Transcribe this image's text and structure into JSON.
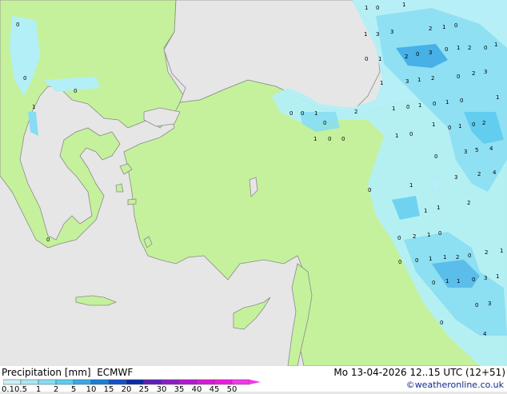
{
  "header": {
    "product": "Precipitation [mm]",
    "model": "ECMWF",
    "valid_time": "Mo 13-04-2026 12..15 UTC (12+51)",
    "credit": "©weatheronline.co.uk"
  },
  "legend": {
    "ticks": [
      "0.1",
      "0.5",
      "1",
      "2",
      "5",
      "10",
      "15",
      "20",
      "25",
      "30",
      "35",
      "40",
      "45",
      "50"
    ],
    "colors": [
      "#c8f0f8",
      "#a8e6f5",
      "#86dcf2",
      "#5ecbef",
      "#3aa7e4",
      "#1a7fd6",
      "#1550c8",
      "#0c2aa6",
      "#5a1fb8",
      "#8b1cc9",
      "#b418d2",
      "#d818d8",
      "#f018e0",
      "#f535ea"
    ]
  },
  "colors": {
    "land": "#c5f19c",
    "sea": "#e6e6e6",
    "rain_light": "#b3eff7",
    "rain_mid": "#7fdcf0",
    "rain_heavy": "#3aa7e4"
  },
  "map_values": [
    "1",
    "0",
    "1",
    "1",
    "3",
    "3",
    "2",
    "1",
    "0",
    "0",
    "1",
    "2",
    "0",
    "3",
    "0",
    "1",
    "2",
    "0",
    "1",
    "1",
    "3",
    "1",
    "2",
    "0",
    "2",
    "3",
    "1",
    "0",
    "1",
    "0",
    "1",
    "0",
    "1",
    "0",
    "0",
    "1",
    "2",
    "0",
    "1",
    "0",
    "1",
    "0",
    "2",
    "5",
    "1",
    "0",
    "3",
    "4",
    "1",
    "0",
    "4",
    "0",
    "3",
    "2",
    "0",
    "2",
    "1",
    "1",
    "1",
    "2",
    "0",
    "1",
    "0",
    "0",
    "1",
    "1",
    "2",
    "0",
    "2",
    "1",
    "0",
    "0",
    "1",
    "1",
    "0",
    "3",
    "1",
    "3",
    "0",
    "0",
    "4",
    "0",
    "0",
    "1",
    "0",
    "0",
    "0"
  ]
}
